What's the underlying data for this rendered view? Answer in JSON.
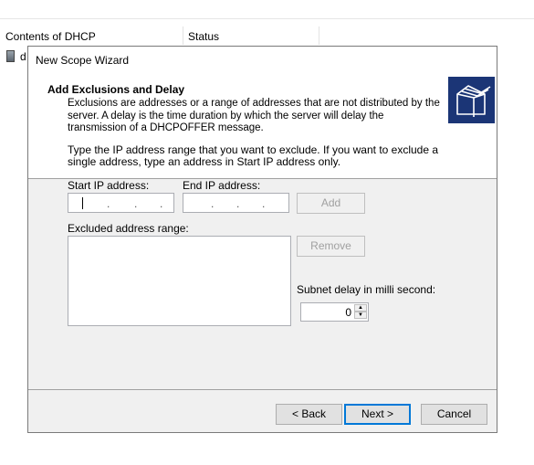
{
  "mmc": {
    "columns": [
      "Contents of DHCP",
      "Status"
    ],
    "row_label": "d"
  },
  "dialog": {
    "title": "New Scope Wizard",
    "header_title": "Add Exclusions and Delay",
    "header_desc": "Exclusions are addresses or a range of addresses that are not distributed by the server. A delay is the time duration by which the server will delay the transmission of a DHCPOFFER message.",
    "header_icon": "folders-icon",
    "instructions": "Type the IP address range that you want to exclude. If you want to exclude a single address, type an address in Start IP address only.",
    "start_ip_label": "Start IP address:",
    "end_ip_label": "End IP address:",
    "start_ip_value": "",
    "end_ip_value": "",
    "add_label": "Add",
    "excluded_label": "Excluded address range:",
    "excluded_items": [],
    "remove_label": "Remove",
    "subnet_delay_label": "Subnet delay in milli second:",
    "subnet_delay_value": "0",
    "back_label": "< Back",
    "next_label": "Next >",
    "cancel_label": "Cancel"
  },
  "colors": {
    "dialog_bg": "#f0f0f0",
    "header_bg": "#ffffff",
    "default_button_border": "#0078d7",
    "wizard_icon_bg": "#1b3576"
  }
}
